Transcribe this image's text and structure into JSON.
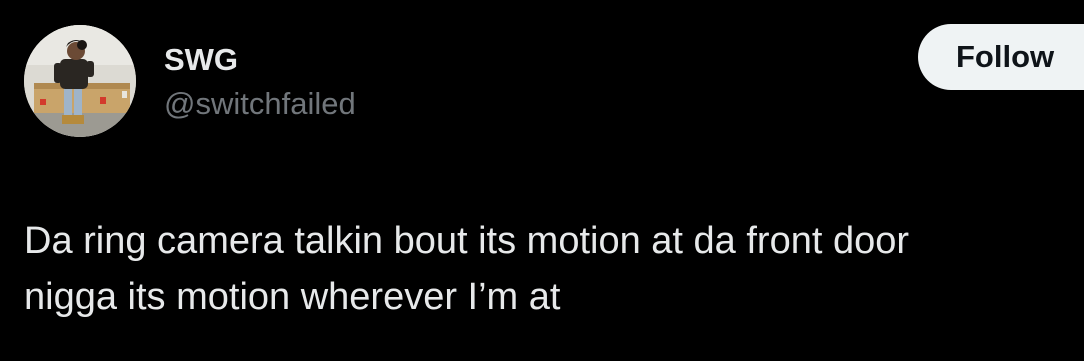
{
  "user": {
    "display_name": "SWG",
    "handle": "@switchfailed",
    "avatar_icon": "profile-photo"
  },
  "follow_button": {
    "label": "Follow"
  },
  "tweet": {
    "lines": [
      "Da ring camera talkin bout its motion at da front door",
      "nigga its motion wherever I’m at"
    ]
  },
  "colors": {
    "background": "#000000",
    "primary_text": "#E7E9EA",
    "secondary_text": "#71767B",
    "button_bg": "#EFF3F4",
    "button_text": "#0F1419"
  }
}
